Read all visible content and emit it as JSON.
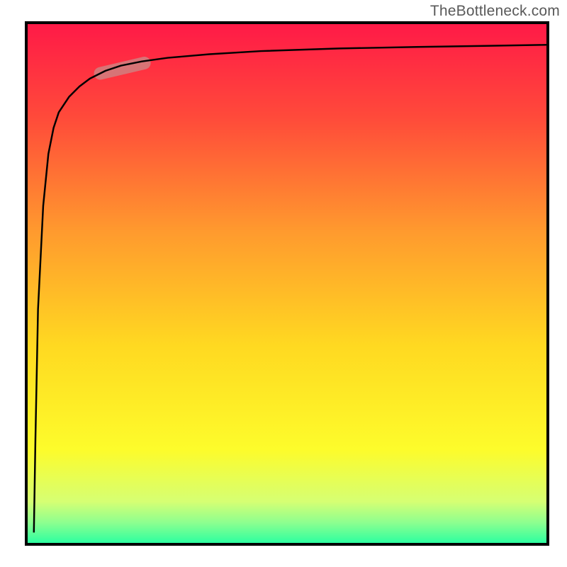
{
  "watermark": "TheBottleneck.com",
  "chart_data": {
    "type": "line",
    "title": "",
    "xlabel": "",
    "ylabel": "",
    "xlim": [
      0,
      100
    ],
    "ylim": [
      0,
      100
    ],
    "grid": false,
    "legend": false,
    "background_gradient": {
      "stops": [
        {
          "pos": 0.0,
          "color": "#ff1a47"
        },
        {
          "pos": 0.18,
          "color": "#ff4a3a"
        },
        {
          "pos": 0.4,
          "color": "#ff9a2e"
        },
        {
          "pos": 0.62,
          "color": "#ffd921"
        },
        {
          "pos": 0.82,
          "color": "#fdfc2b"
        },
        {
          "pos": 0.92,
          "color": "#d6ff73"
        },
        {
          "pos": 0.96,
          "color": "#8fff8f"
        },
        {
          "pos": 1.0,
          "color": "#2dffa0"
        }
      ]
    },
    "series": [
      {
        "name": "curve",
        "x": [
          1.2,
          1.5,
          2,
          3,
          4,
          5,
          6,
          8,
          10,
          12,
          15,
          18,
          22,
          27,
          35,
          45,
          60,
          75,
          88,
          100
        ],
        "y": [
          2,
          20,
          45,
          65,
          75,
          80,
          83,
          86,
          88,
          89.5,
          91,
          92,
          92.8,
          93.5,
          94.2,
          94.8,
          95.3,
          95.6,
          95.8,
          96
        ]
      }
    ],
    "highlight_segment": {
      "x": [
        14,
        22.5
      ],
      "y": [
        90.5,
        92.5
      ],
      "color": "#d08080",
      "width": 18
    }
  }
}
